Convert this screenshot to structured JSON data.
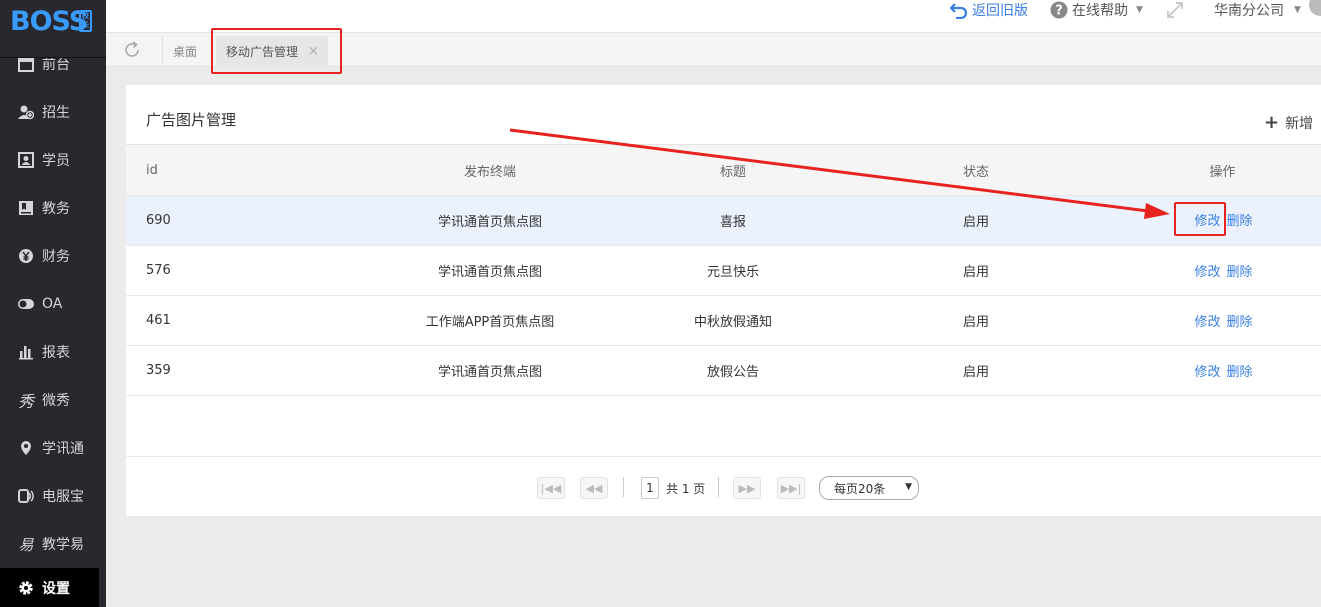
{
  "logo": {
    "text": "BOSS",
    "badge": "校长"
  },
  "sidebar": {
    "items": [
      {
        "label": "前台",
        "icon": "calendar-icon"
      },
      {
        "label": "招生",
        "icon": "user-add-icon"
      },
      {
        "label": "学员",
        "icon": "id-card-icon"
      },
      {
        "label": "教务",
        "icon": "book-icon"
      },
      {
        "label": "财务",
        "icon": "yen-icon"
      },
      {
        "label": "OA",
        "icon": "toggle-icon"
      },
      {
        "label": "报表",
        "icon": "bar-chart-icon"
      },
      {
        "label": "微秀",
        "icon": "xiu-icon"
      },
      {
        "label": "学讯通",
        "icon": "location-pin-icon"
      },
      {
        "label": "电服宝",
        "icon": "phone-service-icon"
      },
      {
        "label": "教学易",
        "icon": "yi-icon"
      }
    ],
    "active_item": {
      "label": "设置",
      "icon": "gear-icon"
    }
  },
  "topbar": {
    "return_old": "返回旧版",
    "help": "在线帮助",
    "branch": "华南分公司"
  },
  "tabs": [
    {
      "label": "桌面"
    },
    {
      "label": "移动广告管理",
      "close": "×"
    }
  ],
  "panel": {
    "title": "广告图片管理",
    "add_label": "新增",
    "columns": [
      "id",
      "发布终端",
      "标题",
      "状态",
      "操作"
    ],
    "rows": [
      {
        "id": "690",
        "terminal": "学讯通首页焦点图",
        "title": "喜报",
        "status": "启用",
        "edit": "修改",
        "delete": "删除"
      },
      {
        "id": "576",
        "terminal": "学讯通首页焦点图",
        "title": "元旦快乐",
        "status": "启用",
        "edit": "修改",
        "delete": "删除"
      },
      {
        "id": "461",
        "terminal": "工作端APP首页焦点图",
        "title": "中秋放假通知",
        "status": "启用",
        "edit": "修改",
        "delete": "删除"
      },
      {
        "id": "359",
        "terminal": "学讯通首页焦点图",
        "title": "放假公告",
        "status": "启用",
        "edit": "修改",
        "delete": "删除"
      }
    ],
    "pager": {
      "current_page": "1",
      "total_text": "共 1 页",
      "page_size": "每页20条"
    }
  },
  "colors": {
    "sidebar_bg": "#28282e",
    "accent_blue": "#3a7fe6",
    "annotation_red": "#e8231f",
    "selected_row_bg": "#ebf2fd"
  }
}
